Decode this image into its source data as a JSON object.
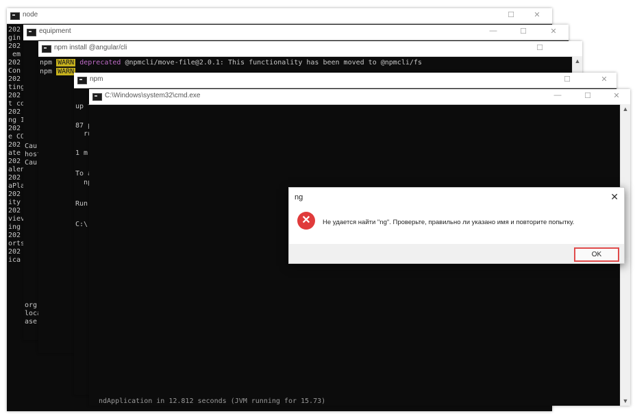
{
  "windows": {
    "w1": {
      "title": "node",
      "left_text": [
        "202",
        "gin",
        "202",
        " em",
        "202",
        "Con",
        "202",
        "ting",
        "202",
        "t co",
        "202",
        "ng I",
        "202",
        "e CO",
        "202",
        "ate",
        "202",
        "alen",
        "202",
        "aPla",
        "202",
        "ity",
        "202",
        "viev",
        "ing",
        "202",
        "orts",
        "202",
        "ica"
      ]
    },
    "w2": {
      "title": "equipment",
      "left_text": [
        "Cau",
        "host",
        "Cau",
        "",
        "",
        "",
        "",
        "",
        "",
        "",
        "",
        "org",
        "loca",
        "ase"
      ]
    },
    "w3": {
      "title": "npm install @angular/cli",
      "line1_prefix": "npm",
      "line1_warn": "WARN",
      "line1_deprecated": "deprecated",
      "line1_rest": " @npmcli/move-file@2.0.1: This functionality has been moved to @npmcli/fs",
      "line2_prefix": "npm",
      "line2_warn": "WARN"
    },
    "w4": {
      "title": "npm",
      "lines": [
        "up t",
        "87 p",
        "  ru",
        "1 m",
        "To a",
        "  np",
        "Run",
        "C:\\"
      ]
    },
    "w5": {
      "title": "C:\\Windows\\system32\\cmd.exe",
      "bottom_text": "ndApplication in 12.812 seconds (JVM running for 15.73)"
    }
  },
  "controls": {
    "minimize": "—",
    "maximize": "☐",
    "close": "✕"
  },
  "dialog": {
    "title": "ng",
    "message": "Не удается найти \"ng\". Проверьте, правильно ли указано имя и повторите попытку.",
    "ok_label": "OK",
    "close_glyph": "✕",
    "error_glyph": "✕",
    "error_color": "#e03b3b",
    "icon": "error-icon"
  }
}
